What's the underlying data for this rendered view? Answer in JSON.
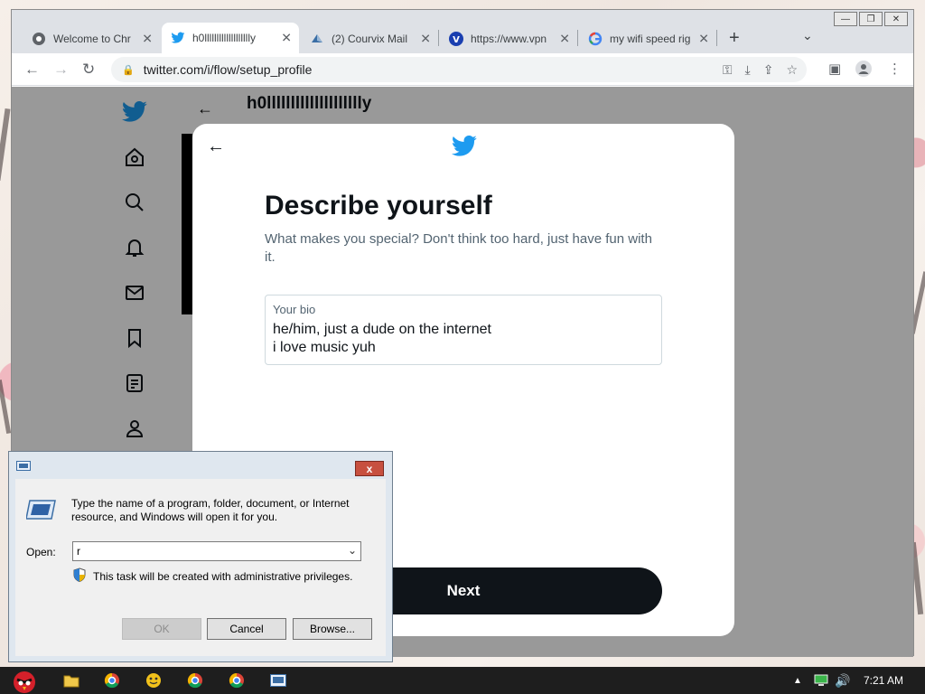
{
  "browser": {
    "tabs": [
      {
        "title": "Welcome to Chr",
        "favicon": "chrome-icon",
        "active": false
      },
      {
        "title": "h0llllllllllllllllllly",
        "favicon": "twitter-icon",
        "active": true
      },
      {
        "title": "(2) Courvix Mail",
        "favicon": "courvix-icon",
        "active": false
      },
      {
        "title": "https://www.vpn",
        "favicon": "vpn-icon",
        "active": false
      },
      {
        "title": "my wifi speed rig",
        "favicon": "google-icon",
        "active": false
      }
    ],
    "url": "twitter.com/i/flow/setup_profile",
    "close_glyph": "✕",
    "newtab_glyph": "+"
  },
  "twitter": {
    "profile_name": "h0lllllllllllllllllllly",
    "modal": {
      "title": "Describe yourself",
      "subtitle": "What makes you special? Don't think too hard, just have fun with it.",
      "bio_label": "Your bio",
      "bio_value": "he/him, just a dude on the internet\ni love music yuh",
      "next_label": "Next"
    },
    "accent_color": "#1d9bf0"
  },
  "run_dialog": {
    "description": "Type the name of a program, folder, document, or Internet resource, and Windows will open it for you.",
    "open_label": "Open:",
    "input_value": "r",
    "admin_note": "This task will be created with administrative privileges.",
    "ok_label": "OK",
    "cancel_label": "Cancel",
    "browse_label": "Browse...",
    "close_glyph": "x"
  },
  "taskbar": {
    "time": "7:21 AM"
  }
}
